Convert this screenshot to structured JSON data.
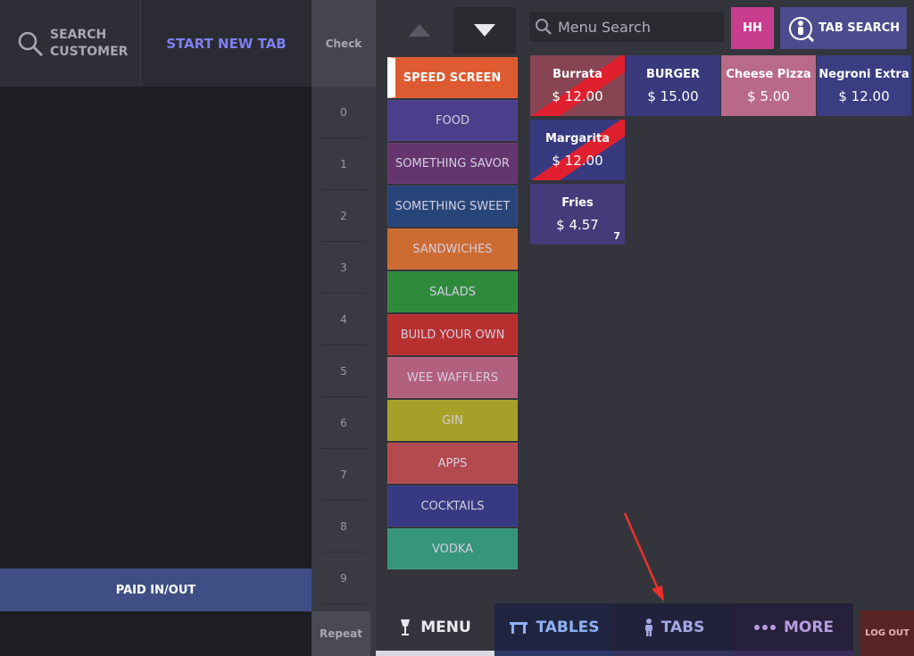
{
  "left": {
    "search_customer": "SEARCH CUSTOMER",
    "start_new_tab": "START NEW TAB",
    "paid_inout": "PAID IN/OUT"
  },
  "numpad": {
    "check_label": "Check",
    "numbers": [
      "0",
      "1",
      "2",
      "3",
      "4",
      "5",
      "6",
      "7",
      "8",
      "9"
    ],
    "repeat_label": "Repeat"
  },
  "categories": [
    {
      "label": "SPEED SCREEN",
      "color": "#de5a30",
      "active": true
    },
    {
      "label": "FOOD",
      "color": "#4a3f8a"
    },
    {
      "label": "SOMETHING SAVOR",
      "color": "#64356f"
    },
    {
      "label": "SOMETHING SWEET",
      "color": "#28457a"
    },
    {
      "label": "SANDWICHES",
      "color": "#cc6b32"
    },
    {
      "label": "SALADS",
      "color": "#2f8a3c"
    },
    {
      "label": "BUILD YOUR OWN",
      "color": "#b7302f"
    },
    {
      "label": "WEE WAFFLERS",
      "color": "#b35f7e"
    },
    {
      "label": "GIN",
      "color": "#a7a028"
    },
    {
      "label": "APPS",
      "color": "#b34a4f"
    },
    {
      "label": "COCKTAILS",
      "color": "#373a82"
    },
    {
      "label": "VODKA",
      "color": "#36957a"
    }
  ],
  "search": {
    "placeholder": "Menu Search",
    "hh_label": "HH",
    "tab_search_label": "TAB SEARCH"
  },
  "items": [
    {
      "name": "Burrata",
      "price": "$ 12.00",
      "color": "#874553",
      "striped": true
    },
    {
      "name": "BURGER",
      "price": "$ 15.00",
      "color": "#383a7c"
    },
    {
      "name": "Cheese Pizza",
      "price": "$ 5.00",
      "color": "#b86a88"
    },
    {
      "name": "Negroni Extra",
      "price": "$ 12.00",
      "color": "#3a3d82"
    },
    {
      "name": "Margarita",
      "price": "$ 12.00",
      "color": "#383a80",
      "striped": true
    },
    {
      "name": "Fries",
      "price": "$ 4.57",
      "color": "#453a7a",
      "badge": "7"
    }
  ],
  "nav": {
    "menu": "MENU",
    "tables": "TABLES",
    "tabs": "TABS",
    "more": "MORE",
    "logout": "LOG OUT"
  },
  "colors": {
    "accent_new_tab": "#7d7ff0",
    "hh": "#c93d8e",
    "tab_search": "#4b4b8e",
    "annotation_arrow": "#e8322b"
  }
}
